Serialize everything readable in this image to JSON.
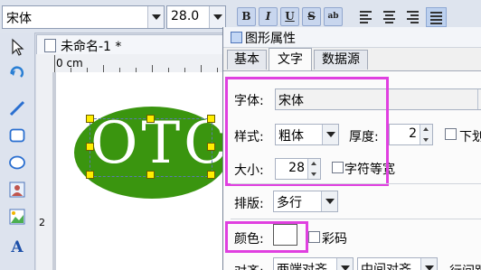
{
  "toolbar": {
    "font_family": "宋体",
    "font_size": "28.0",
    "bold_label": "B",
    "italic_label": "I",
    "underline_label": "U",
    "strike_label": "S",
    "spacing_label": "ab",
    "icons": [
      "align-left-icon",
      "align-center-icon",
      "align-right-icon",
      "align-justify-icon"
    ]
  },
  "left_tools": [
    "pointer-icon",
    "rotate-icon",
    "line-tool-icon",
    "rectangle-tool-icon",
    "ellipse-tool-icon",
    "image-tool-icon",
    "picture-tool-icon",
    "text-tool-icon"
  ],
  "document": {
    "tab_title": "未命名-1 *",
    "ruler_unit": "0 cm",
    "ruler_mark": "2"
  },
  "canvas": {
    "text": "OTC",
    "shape_color": "#3a950f",
    "text_color": "#ffffff"
  },
  "dialog": {
    "title": "图形属性",
    "tabs": [
      "基本",
      "文字",
      "数据源"
    ],
    "active_tab": "文字",
    "font_label": "字体:",
    "font_value": "宋体",
    "style_label": "样式:",
    "style_value": "粗体",
    "thickness_label": "厚度:",
    "thickness_value": "2",
    "underline_label": "下划",
    "size_label": "大小:",
    "size_value": "28",
    "fixed_width_label": "字符等宽",
    "layout_label": "排版:",
    "layout_value": "多行",
    "color_label": "颜色:",
    "color_value": "#ffffff",
    "multicolor_label": "彩码",
    "alignment_label": "对齐:",
    "h_align_value": "两端对齐",
    "v_align_value": "中间对齐",
    "line_spacing_label": "行间距",
    "highlight_color": "#e040e0"
  }
}
